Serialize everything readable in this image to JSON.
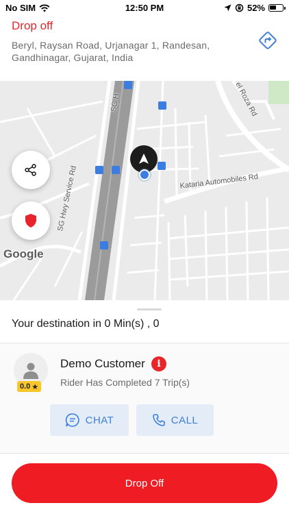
{
  "status_bar": {
    "carrier": "No SIM",
    "time": "12:50 PM",
    "battery": "52%",
    "icons": [
      "wifi-icon",
      "location-arrow-icon",
      "orientation-lock-icon",
      "battery-icon"
    ]
  },
  "header": {
    "title": "Drop off",
    "address": "Beryl, Raysan Road, Urjanagar 1, Randesan, Gandhinagar, Gujarat, India",
    "nav_icon": "directions-icon"
  },
  "map": {
    "street_labels": [
      "SG Hwy Service Rd",
      "Kataria Automobiles Rd",
      "SG H",
      "el Roza Rd"
    ],
    "logo": "Google",
    "share_icon": "share-icon",
    "shield_icon": "shield-icon"
  },
  "trip": {
    "destination_text": "Your destination in 0 Min(s) , 0"
  },
  "rider": {
    "name": "Demo Customer",
    "rating": "0.0",
    "subtitle": "Rider Has Completed 7 Trip(s)",
    "info_icon_glyph": "i"
  },
  "actions": {
    "chat_label": "CHAT",
    "call_label": "CALL"
  },
  "footer": {
    "dropoff_label": "Drop Off"
  },
  "colors": {
    "accent_red": "#e8252b",
    "button_red": "#ef1c24",
    "action_blue": "#3d7fd9",
    "action_bg": "#e4ecf7",
    "rating_yellow": "#f7c52c"
  }
}
